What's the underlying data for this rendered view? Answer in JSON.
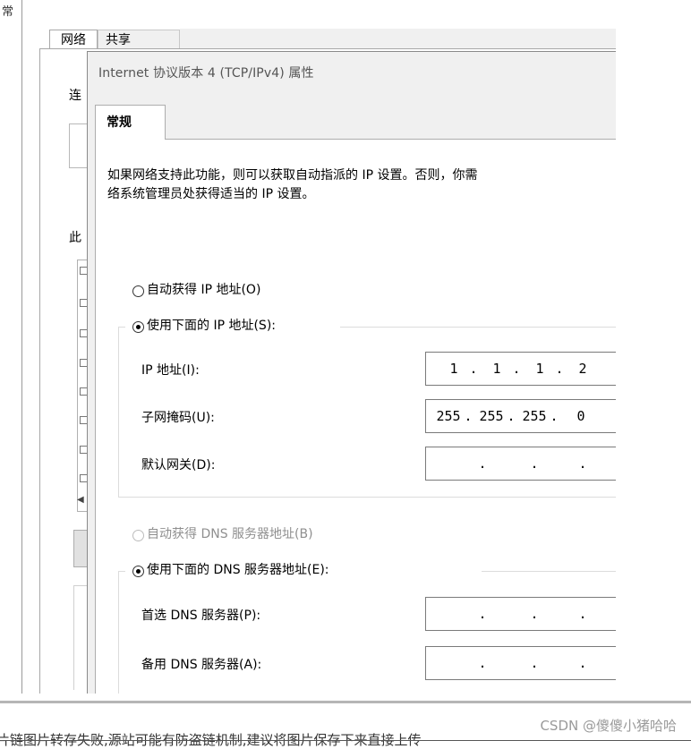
{
  "background_window": {
    "top_glyph": "常",
    "tabs": [
      "网络",
      "共享"
    ],
    "fragments": [
      "连",
      "此"
    ]
  },
  "dialog": {
    "title": "Internet 协议版本 4 (TCP/IPv4) 属性",
    "tab": "常规",
    "description_line1": "如果网络支持此功能，则可以获取自动指派的 IP 设置。否则，你需",
    "description_line2": "络系统管理员处获得适当的 IP 设置。",
    "ip_auto_label": "自动获得 IP 地址(O)",
    "ip_manual_label": "使用下面的 IP 地址(S):",
    "ip_mode": "manual",
    "fields": {
      "ip_label": "IP 地址(I):",
      "ip_value": [
        "1",
        "1",
        "1",
        "2"
      ],
      "mask_label": "子网掩码(U):",
      "mask_value": [
        "255",
        "255",
        "255",
        "0"
      ],
      "gateway_label": "默认网关(D):",
      "gateway_value": [
        "",
        "",
        "",
        ""
      ]
    },
    "dns_auto_label": "自动获得 DNS 服务器地址(B)",
    "dns_manual_label": "使用下面的 DNS 服务器地址(E):",
    "dns_mode": "manual",
    "dns": {
      "preferred_label": "首选 DNS 服务器(P):",
      "preferred_value": [
        "",
        "",
        "",
        ""
      ],
      "alternate_label": "备用 DNS 服务器(A):",
      "alternate_value": [
        "",
        "",
        "",
        ""
      ]
    }
  },
  "footer": {
    "watermark": "CSDN @傻傻小猪哈哈",
    "cut_text": "片链图片转存失败,源站可能有防盗链机制,建议将图片保存下来直接上传"
  }
}
